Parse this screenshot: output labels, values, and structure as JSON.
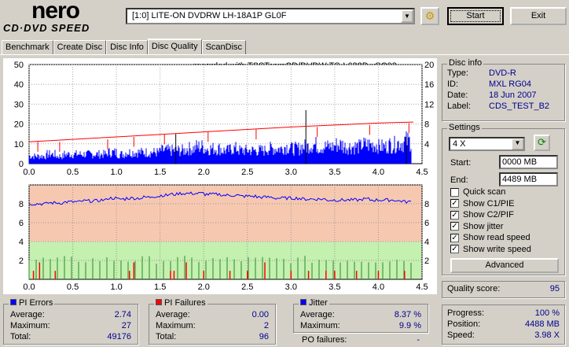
{
  "app": {
    "logo_top": "nero",
    "logo_bottom": "CD·DVD SPEED"
  },
  "toolbar": {
    "drive": "[1:0]  LITE-ON DVDRW LH-18A1P GL0F",
    "start": "Start",
    "exit": "Exit"
  },
  "tabs": [
    "Benchmark",
    "Create Disc",
    "Disc Info",
    "Disc Quality",
    "ScanDisc"
  ],
  "chart_note": "recorded with TSSTcorpCD/DVDW TS-L632D vSC03",
  "disc_info": {
    "title": "Disc info",
    "rows": [
      {
        "k": "Type:",
        "v": "DVD-R"
      },
      {
        "k": "ID:",
        "v": "MXL RG04"
      },
      {
        "k": "Date:",
        "v": "18 Jun 2007"
      },
      {
        "k": "Label:",
        "v": "CDS_TEST_B2"
      }
    ]
  },
  "settings": {
    "title": "Settings",
    "speed": "4 X",
    "start_label": "Start:",
    "start": "0000 MB",
    "end_label": "End:",
    "end": "4489 MB",
    "checks": [
      {
        "label": "Quick scan",
        "on": false
      },
      {
        "label": "Show C1/PIE",
        "on": true
      },
      {
        "label": "Show C2/PIF",
        "on": true
      },
      {
        "label": "Show jitter",
        "on": true
      },
      {
        "label": "Show read speed",
        "on": true
      },
      {
        "label": "Show write speed",
        "on": true
      }
    ],
    "advanced": "Advanced"
  },
  "quality": {
    "label": "Quality score:",
    "value": "95"
  },
  "pi_errors": {
    "title": "PI Errors",
    "color": "#0000ff",
    "rows": [
      {
        "k": "Average:",
        "v": "2.74"
      },
      {
        "k": "Maximum:",
        "v": "27"
      },
      {
        "k": "Total:",
        "v": "49176"
      }
    ]
  },
  "pi_failures": {
    "title": "PI Failures",
    "color": "#ff0000",
    "rows": [
      {
        "k": "Average:",
        "v": "0.00"
      },
      {
        "k": "Maximum:",
        "v": "2"
      },
      {
        "k": "Total:",
        "v": "96"
      }
    ]
  },
  "jitter": {
    "title": "Jitter",
    "color": "#0000ff",
    "rows": [
      {
        "k": "Average:",
        "v": "8.37 %"
      },
      {
        "k": "Maximum:",
        "v": "9.9 %"
      }
    ],
    "po_label": "PO failures:",
    "po_value": "-"
  },
  "progress": {
    "rows": [
      {
        "k": "Progress:",
        "v": "100 %"
      },
      {
        "k": "Position:",
        "v": "4488 MB"
      },
      {
        "k": "Speed:",
        "v": "3.98 X"
      }
    ]
  },
  "chart_data": [
    {
      "type": "bar",
      "name": "PI errors + read speed",
      "x_ticks": [
        "0.0",
        "0.5",
        "1.0",
        "1.5",
        "2.0",
        "2.5",
        "3.0",
        "3.5",
        "4.0",
        "4.5"
      ],
      "xlim": [
        0,
        4.5
      ],
      "y_left_ticks": [
        "10",
        "20",
        "30",
        "40",
        "50"
      ],
      "ylim_left": [
        0,
        50
      ],
      "y_right_ticks": [
        "4",
        "8",
        "12",
        "16",
        "20"
      ],
      "ylim_right": [
        0,
        20
      ],
      "pie_x_step": 0.1,
      "pie_values": [
        4,
        4,
        5,
        4,
        5,
        5,
        5,
        5,
        5,
        6,
        5,
        6,
        6,
        6,
        6,
        7,
        7,
        7,
        8,
        9,
        8,
        8,
        7,
        8,
        7,
        7,
        7,
        8,
        8,
        9,
        8,
        9,
        10,
        9,
        9,
        10,
        9,
        9,
        10,
        10,
        9,
        10,
        11,
        12,
        12
      ],
      "pie_spikes": [
        {
          "x": 3.17,
          "y": 27
        },
        {
          "x": 1.68,
          "y": 15
        },
        {
          "x": 4.32,
          "y": 14
        }
      ],
      "speed_x": [
        0,
        0.5,
        1,
        1.5,
        2,
        2.5,
        3,
        3.5,
        4,
        4.4
      ],
      "speed_values": [
        4.4,
        4.9,
        5.4,
        5.9,
        6.4,
        6.9,
        7.4,
        7.8,
        8.2,
        8.4
      ]
    },
    {
      "type": "line",
      "name": "Jitter + PI failures",
      "x_ticks": [
        "0.0",
        "0.5",
        "1.0",
        "1.5",
        "2.0",
        "2.5",
        "3.0",
        "3.5",
        "4.0",
        "4.5"
      ],
      "xlim": [
        0,
        4.5
      ],
      "y_left_ticks": [
        "2",
        "4",
        "6",
        "8",
        "10"
      ],
      "ylim_left": [
        0,
        10
      ],
      "y_right_ticks": [
        "2",
        "4",
        "6",
        "8",
        "10"
      ],
      "jitter_x_step": 0.1,
      "jitter_values": [
        8.0,
        8.0,
        8.1,
        8.1,
        8.2,
        8.2,
        8.3,
        8.3,
        8.4,
        8.6,
        8.5,
        8.6,
        8.6,
        8.7,
        8.8,
        8.9,
        9.0,
        9.1,
        9.1,
        9.1,
        9.0,
        9.0,
        8.9,
        8.9,
        8.8,
        8.8,
        8.7,
        8.7,
        8.6,
        8.6,
        8.6,
        8.5,
        8.5,
        8.5,
        8.4,
        8.4,
        8.4,
        8.4,
        8.5,
        8.4,
        8.4,
        8.4,
        8.3,
        8.2,
        8.1
      ],
      "pif_x": [
        0.05,
        0.12,
        0.3,
        1.15,
        1.2,
        1.62,
        1.66,
        1.8,
        2.0,
        2.3,
        2.5,
        2.7,
        3.0,
        3.2,
        3.4,
        3.5,
        3.75,
        4.0,
        4.3
      ],
      "pif_values": [
        1,
        2,
        1,
        1,
        2,
        1,
        1,
        2,
        1,
        1,
        1,
        2,
        1,
        1,
        1,
        1,
        1,
        1,
        1
      ]
    }
  ]
}
